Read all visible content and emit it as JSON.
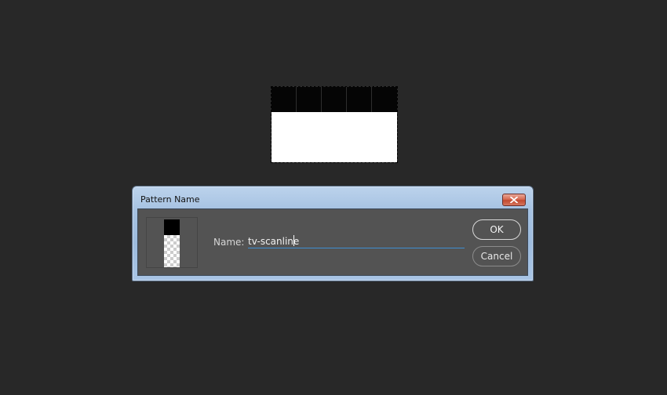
{
  "dialog": {
    "title": "Pattern Name",
    "close_icon": "close-icon",
    "name_label": "Name:",
    "name_value": "tv-scanline",
    "ok_label": "OK",
    "cancel_label": "Cancel",
    "field_underline_color": "#3f8fd2"
  },
  "canvas": {
    "background_color": "#282828",
    "selection_top_color": "#000000",
    "selection_bottom_color": "#ffffff"
  }
}
